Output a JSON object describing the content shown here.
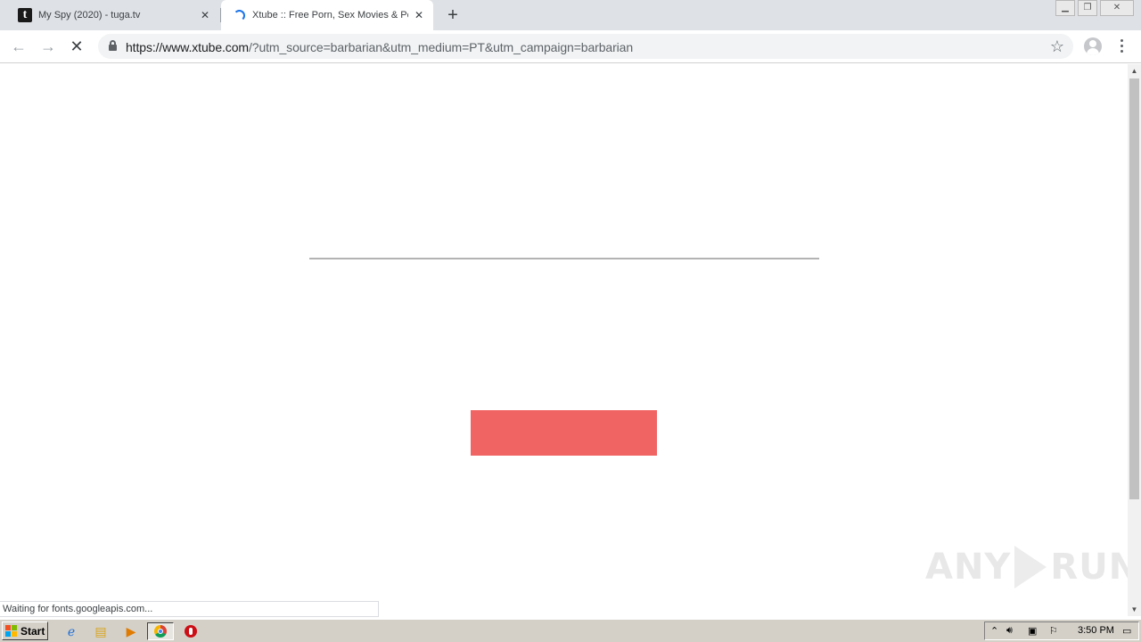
{
  "browser": {
    "tabs": [
      {
        "title": "My Spy (2020) - tuga.tv",
        "active": false
      },
      {
        "title": "Xtube :: Free Porn, Sex Movies & Po",
        "active": true
      }
    ],
    "address": {
      "host": "https://www.xtube.com",
      "path": "/?utm_source=barbarian&utm_medium=PT&utm_campaign=barbarian"
    },
    "status_text": "Waiting for fonts.googleapis.com..."
  },
  "page": {
    "loading_progress_percent": 0,
    "block_color": "#f16464"
  },
  "watermark": {
    "left": "ANY",
    "right": "RUN"
  },
  "taskbar": {
    "start_label": "Start",
    "clock": "3:50 PM"
  }
}
